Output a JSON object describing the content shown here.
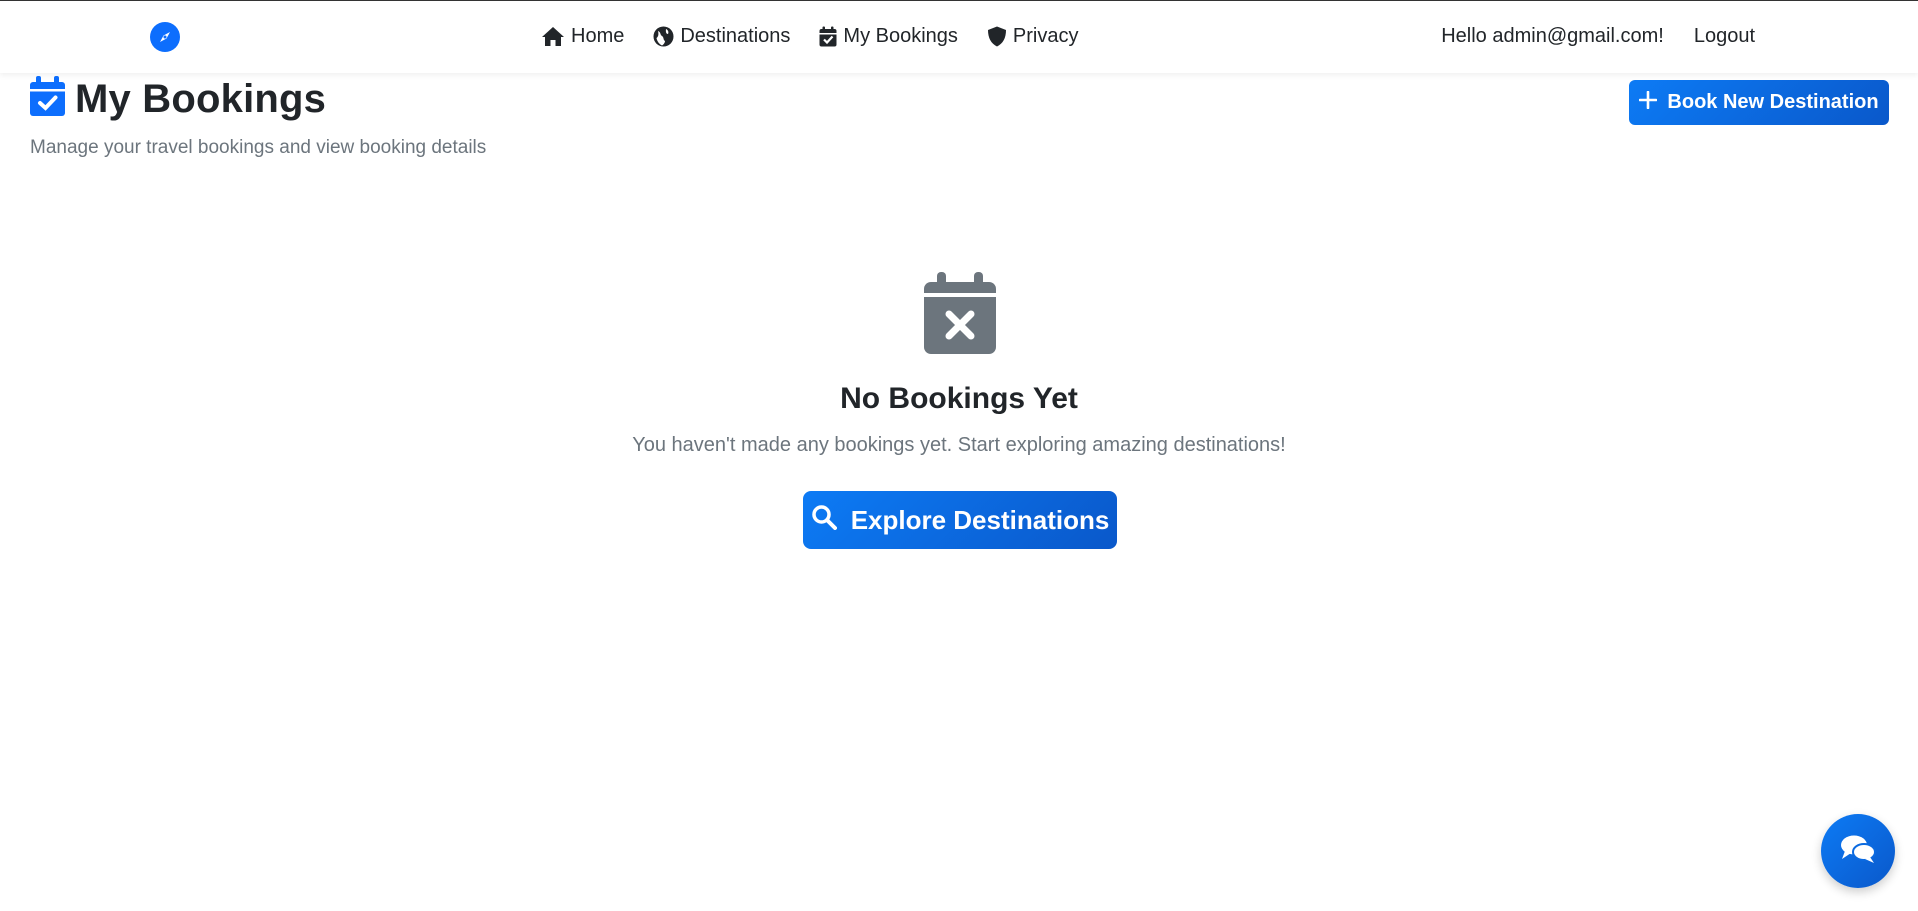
{
  "navbar": {
    "brand_icon": "compass-icon",
    "links": [
      {
        "label": "Home",
        "icon": "home-icon"
      },
      {
        "label": "Destinations",
        "icon": "globe-icon"
      },
      {
        "label": "My Bookings",
        "icon": "calendar-check-icon"
      },
      {
        "label": "Privacy",
        "icon": "shield-icon"
      }
    ],
    "greeting": "Hello admin@gmail.com!",
    "logout_label": "Logout"
  },
  "header": {
    "title": "My Bookings",
    "title_icon": "calendar-check-icon",
    "subtitle": "Manage your travel bookings and view booking details",
    "book_button_label": "Book New Destination",
    "book_button_icon": "plus-icon"
  },
  "empty_state": {
    "icon": "calendar-x-icon",
    "title": "No Bookings Yet",
    "text": "You haven't made any bookings yet. Start exploring amazing destinations!",
    "button_label": "Explore Destinations",
    "button_icon": "search-icon"
  },
  "chat": {
    "icon": "chat-bubbles-icon"
  },
  "colors": {
    "primary": "#0d6efd",
    "primary_dark": "#0a58ca",
    "muted": "#6c757d",
    "text": "#212529"
  }
}
